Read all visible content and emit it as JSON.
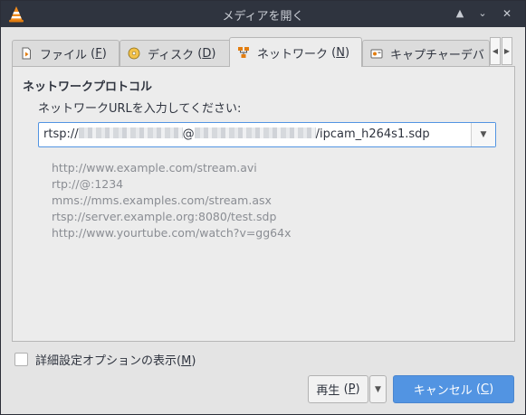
{
  "window": {
    "title": "メディアを開く"
  },
  "tabs": [
    {
      "label": "ファイル",
      "mnemonic": "F",
      "icon": "file-icon"
    },
    {
      "label": "ディスク",
      "mnemonic": "D",
      "icon": "disc-icon"
    },
    {
      "label": "ネットワーク",
      "mnemonic": "N",
      "icon": "network-icon",
      "active": true
    },
    {
      "label": "キャプチャーデバ",
      "icon": "capture-device-icon"
    }
  ],
  "network": {
    "group_title": "ネットワークプロトコル",
    "prompt": "ネットワークURLを入力してください:",
    "url_prefix": "rtsp://",
    "url_at": "@",
    "url_suffix": "/ipcam_h264s1.sdp",
    "examples": [
      "http://www.example.com/stream.avi",
      "rtp://@:1234",
      "mms://mms.examples.com/stream.asx",
      "rtsp://server.example.org:8080/test.sdp",
      "http://www.yourtube.com/watch?v=gg64x"
    ]
  },
  "advanced": {
    "label": "詳細設定オプションの表示",
    "mnemonic": "M",
    "checked": false
  },
  "buttons": {
    "play": {
      "label": "再生",
      "mnemonic": "P"
    },
    "cancel": {
      "label": "キャンセル",
      "mnemonic": "C"
    }
  },
  "colors": {
    "accent": "#5294e2",
    "titlebar": "#2f343f",
    "window_bg": "#e4e4e4"
  }
}
